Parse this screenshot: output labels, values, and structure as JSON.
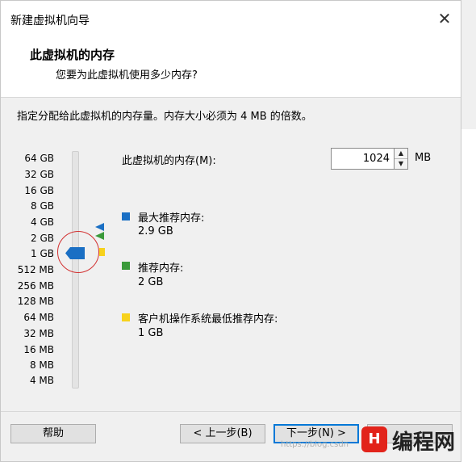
{
  "window": {
    "title": "新建虚拟机向导",
    "close_symbol": "✕"
  },
  "header": {
    "title": "此虚拟机的内存",
    "subtitle": "您要为此虚拟机使用多少内存?"
  },
  "instruction": "指定分配给此虚拟机的内存量。内存大小必须为 4 MB 的倍数。",
  "memory": {
    "label": "此虚拟机的内存(M):",
    "value": "1024",
    "unit": "MB"
  },
  "scale": [
    "64 GB",
    "32 GB",
    "16 GB",
    "8 GB",
    "4 GB",
    "2 GB",
    "1 GB",
    "512 MB",
    "256 MB",
    "128 MB",
    "64 MB",
    "32 MB",
    "16 MB",
    "8 MB",
    "4 MB"
  ],
  "slider": {
    "current": "1 GB",
    "thumb_color": "#1a6fc4"
  },
  "legend": [
    {
      "name": "最大推荐内存:",
      "value": "2.9 GB",
      "color": "#1a6fc4"
    },
    {
      "name": "推荐内存:",
      "value": "2 GB",
      "color": "#3a9a3a"
    },
    {
      "name": "客户机操作系统最低推荐内存:",
      "value": "1 GB",
      "color": "#f7d21c"
    }
  ],
  "buttons": {
    "help": "帮助",
    "back": "< 上一步(B)",
    "next": "下一步(N) >",
    "cancel": ""
  },
  "watermark": {
    "url": "https://blog.csdn",
    "logo_mark": "H",
    "brand": "编程网"
  }
}
